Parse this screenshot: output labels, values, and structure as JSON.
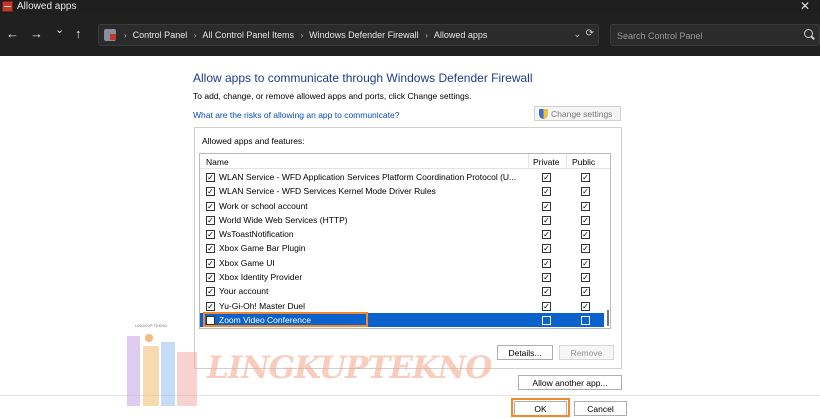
{
  "window": {
    "title": "Allowed apps",
    "close_glyph": "✕"
  },
  "nav": {
    "back": "←",
    "forward": "→",
    "recent": "⌄",
    "up": "↑"
  },
  "breadcrumbs": [
    "Control Panel",
    "All Control Panel Items",
    "Windows Defender Firewall",
    "Allowed apps"
  ],
  "breadcrumb_separator": "›",
  "address": {
    "dropdown": "⌄",
    "refresh": "⟳"
  },
  "search": {
    "placeholder": "Search Control Panel"
  },
  "heading": "Allow apps to communicate through Windows Defender Firewall",
  "subtext": "To add, change, or remove allowed apps and ports, click Change settings.",
  "risk_link": "What are the risks of allowing an app to communicate?",
  "change_settings_label": "Change settings",
  "group_label": "Allowed apps and features:",
  "columns": {
    "name": "Name",
    "private": "Private",
    "public": "Public"
  },
  "apps": [
    {
      "name": "WLAN Service - WFD Application Services Platform Coordination Protocol (U...",
      "enabled": true,
      "private": true,
      "public": true
    },
    {
      "name": "WLAN Service - WFD Services Kernel Mode Driver Rules",
      "enabled": true,
      "private": true,
      "public": true
    },
    {
      "name": "Work or school account",
      "enabled": true,
      "private": true,
      "public": true
    },
    {
      "name": "World Wide Web Services (HTTP)",
      "enabled": true,
      "private": true,
      "public": true
    },
    {
      "name": "WsToastNotification",
      "enabled": true,
      "private": true,
      "public": true
    },
    {
      "name": "Xbox Game Bar Plugin",
      "enabled": true,
      "private": true,
      "public": true
    },
    {
      "name": "Xbox Game UI",
      "enabled": true,
      "private": true,
      "public": true
    },
    {
      "name": "Xbox Identity Provider",
      "enabled": true,
      "private": true,
      "public": true
    },
    {
      "name": "Your account",
      "enabled": true,
      "private": true,
      "public": true
    },
    {
      "name": "Yu-Gi-Oh!  Master Duel",
      "enabled": true,
      "private": true,
      "public": true
    },
    {
      "name": "Zoom Video Conference",
      "enabled": false,
      "private": false,
      "public": false,
      "selected": true
    }
  ],
  "buttons": {
    "details": "Details...",
    "remove": "Remove",
    "allow_another": "Allow another app...",
    "ok": "OK",
    "cancel": "Cancel"
  },
  "watermark": {
    "text": "LINGKUPTEKNO",
    "caption": "LINGKUP TEKNO"
  },
  "colors": {
    "accent": "#f08a2c",
    "selection": "#0b62cc",
    "heading": "#1e3d8f",
    "link": "#0a4fb3"
  }
}
